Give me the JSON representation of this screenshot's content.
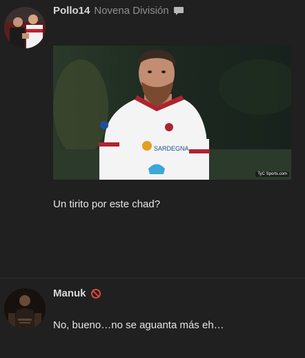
{
  "posts": [
    {
      "username": "Pollo14",
      "rank": "Novena División",
      "rank_icon": "speech-bubble-icon",
      "media": {
        "watermark": "TyC Sports.com",
        "jersey_sponsor": "SARDEGNA"
      },
      "text": "Un tirito por este chad?"
    },
    {
      "username": "Manuk",
      "status_icon": "ban-icon",
      "status_color": "#e0483a",
      "text": "No, bueno…no se aguanta más eh…"
    }
  ]
}
